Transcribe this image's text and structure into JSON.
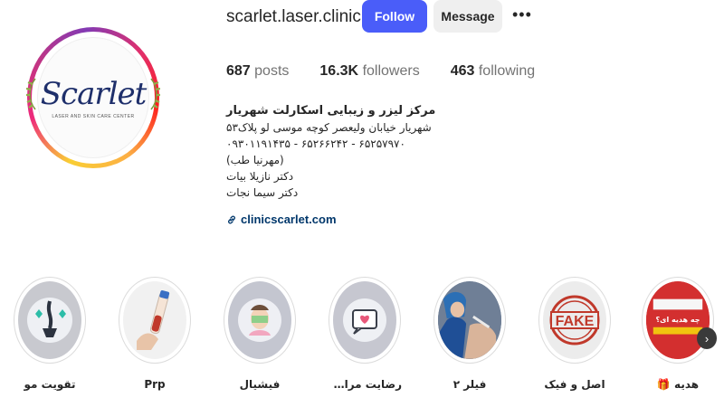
{
  "profile": {
    "username": "scarlet.laser.clinic",
    "follow_label": "Follow",
    "message_label": "Message",
    "more_icon": "ellipsis-icon",
    "avatar": {
      "logo_word": "Scarlet",
      "logo_sub": "LASER AND SKIN CARE CENTER"
    }
  },
  "stats": {
    "posts_count": "687",
    "posts_label": "posts",
    "followers_count": "16.3K",
    "followers_label": "followers",
    "following_count": "463",
    "following_label": "following"
  },
  "bio": {
    "name": "مرکز لیزر و زیبایی اسکارلت شهریار",
    "lines": [
      "شهریار خیابان ولیعصر کوچه موسی لو پلاک۵۳",
      "۰۹۳۰۱۱۹۱۴۳۵ - ۶۵۲۶۶۲۴۲ - ۶۵۲۵۷۹۷۰",
      "(مهرنیا طب)",
      "دکتر نازیلا بیات",
      "دکتر سیما نجات"
    ],
    "link": "clinicscarlet.com"
  },
  "highlights": [
    {
      "label": "تقویت مو",
      "icon": "hair-follicle-icon"
    },
    {
      "label": "Prp",
      "icon": "test-tube-icon"
    },
    {
      "label": "فیشیال",
      "icon": "facial-mask-icon"
    },
    {
      "label": "رضایت مراجعی...",
      "icon": "heart-message-icon"
    },
    {
      "label": "فیلر ۲",
      "icon": "filler-treatment-photo"
    },
    {
      "label": "اصل و فیک",
      "icon": "fake-stamp-icon"
    },
    {
      "label": "هدیه 🎁",
      "icon": "gift-card-icon",
      "card_text": "چه هدیه ای؟"
    }
  ],
  "colors": {
    "follow": "#4a5df9",
    "link": "#00376b",
    "logo": "#1e2f6b"
  }
}
